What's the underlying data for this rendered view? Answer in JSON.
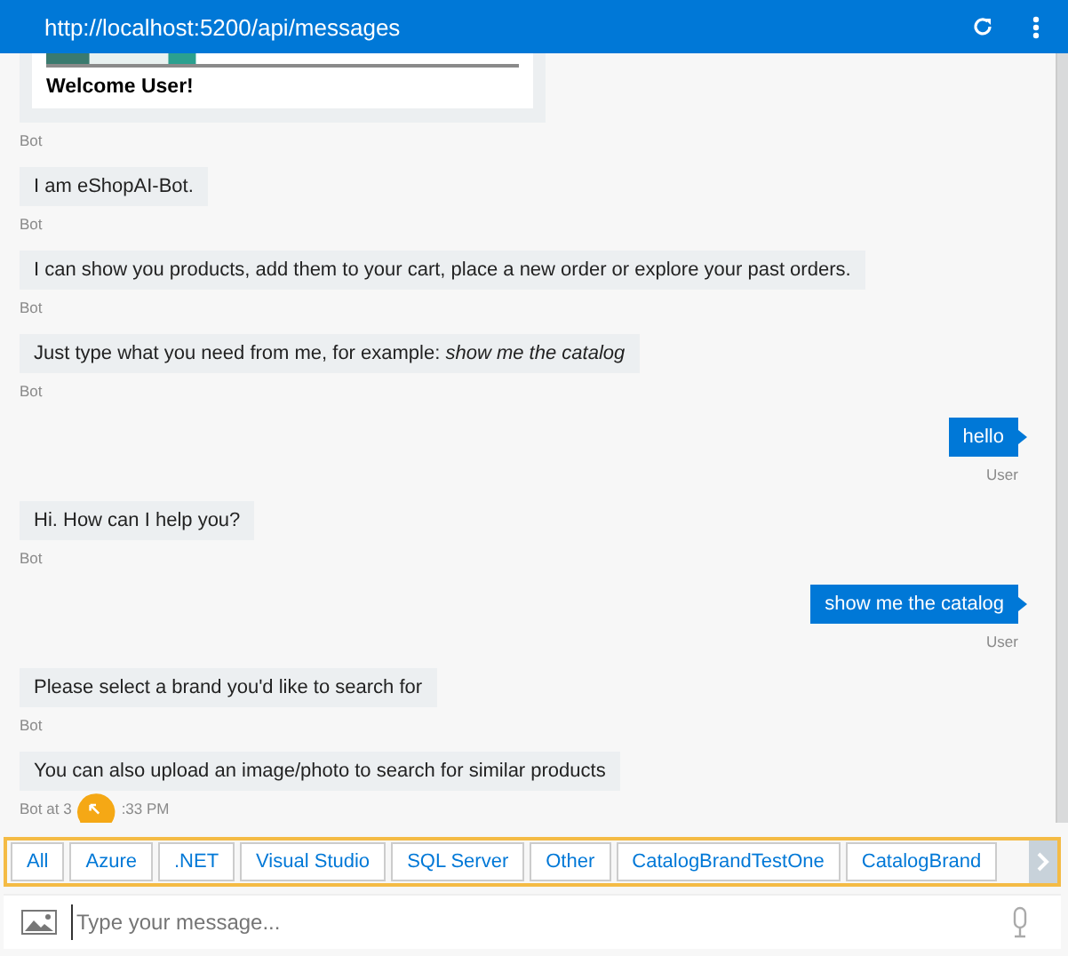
{
  "header": {
    "title": "http://localhost:5200/api/messages"
  },
  "messages": [
    {
      "kind": "card",
      "title": "Welcome User!",
      "from": "Bot"
    },
    {
      "kind": "bot",
      "text": "I am eShopAI-Bot.",
      "from": "Bot"
    },
    {
      "kind": "bot",
      "text": "I can show you products, add them to your cart, place a new order or explore your past orders.",
      "from": "Bot"
    },
    {
      "kind": "bot",
      "text": "Just type what you need from me, for example: *show me the catalog*",
      "from": "Bot"
    },
    {
      "kind": "user",
      "text": "hello",
      "from": "User"
    },
    {
      "kind": "bot",
      "text": "Hi. How can I help you?",
      "from": "Bot"
    },
    {
      "kind": "user",
      "text": "show me the catalog",
      "from": "User"
    },
    {
      "kind": "bot",
      "text": "Please select a brand you'd like to search for",
      "from": "Bot"
    },
    {
      "kind": "bot",
      "text": "You can also upload an image/photo to search for similar products",
      "timestamp_parts": [
        "Bot at 3",
        ":33 PM"
      ]
    }
  ],
  "suggested_actions": [
    "All",
    "Azure",
    ".NET",
    "Visual Studio",
    "SQL Server",
    "Other",
    "CatalogBrandTestOne",
    "CatalogBrand"
  ],
  "input": {
    "placeholder": "Type your message..."
  }
}
